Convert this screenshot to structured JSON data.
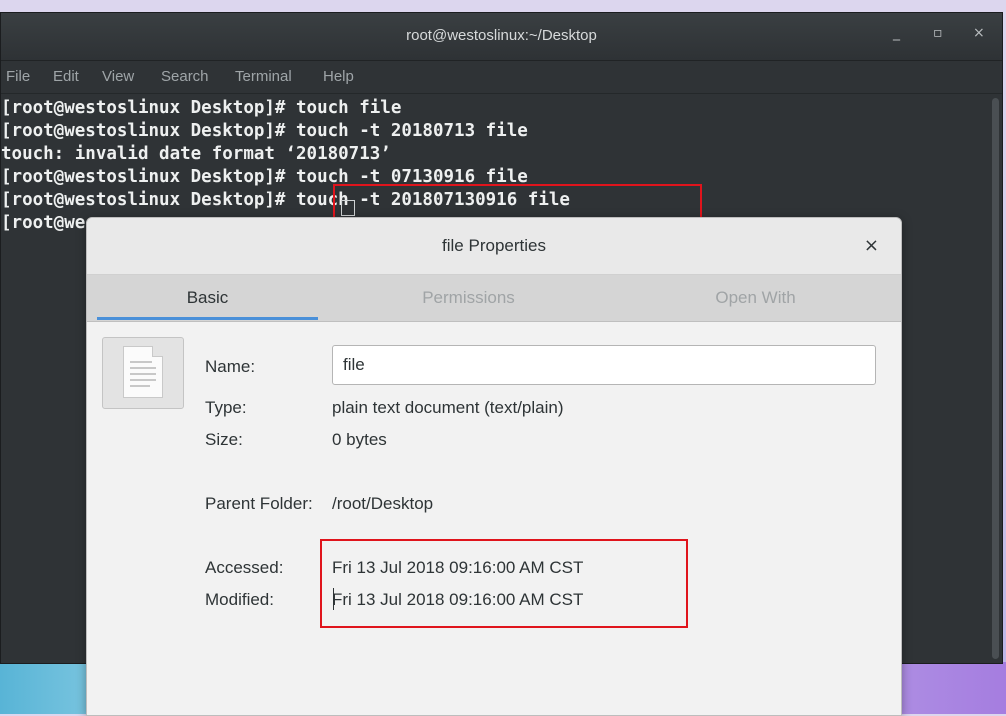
{
  "terminal": {
    "title": "root@westoslinux:~/Desktop",
    "controls": {
      "minimize": "_",
      "maximize": "▫",
      "close": "×"
    },
    "menu": [
      "File",
      "Edit",
      "View",
      "Search",
      "Terminal",
      "Help"
    ],
    "lines": [
      "[root@westoslinux Desktop]# touch file",
      "[root@westoslinux Desktop]# touch -t 20180713 file",
      "touch: invalid date format ‘20180713’",
      "[root@westoslinux Desktop]# touch -t 07130916 file",
      "[root@westoslinux Desktop]# touch -t 201807130916 file",
      "[root@we"
    ]
  },
  "dialog": {
    "title": "file Properties",
    "close": "×",
    "tabs": [
      "Basic",
      "Permissions",
      "Open With"
    ],
    "active_tab": "Basic",
    "name_label": "Name:",
    "name_value": "file",
    "type_label": "Type:",
    "type_value": "plain text document (text/plain)",
    "size_label": "Size:",
    "size_value": "0 bytes",
    "parent_label": "Parent Folder:",
    "parent_value": "/root/Desktop",
    "accessed_label": "Accessed:",
    "accessed_value": "Fri 13 Jul 2018 09:16:00 AM CST",
    "modified_label": "Modified:",
    "modified_value": "Fri 13 Jul 2018 09:16:00 AM CST"
  },
  "colors": {
    "highlight": "#e0141c",
    "tab_accent": "#4a90d9",
    "terminal_bg": "#2f3336"
  }
}
